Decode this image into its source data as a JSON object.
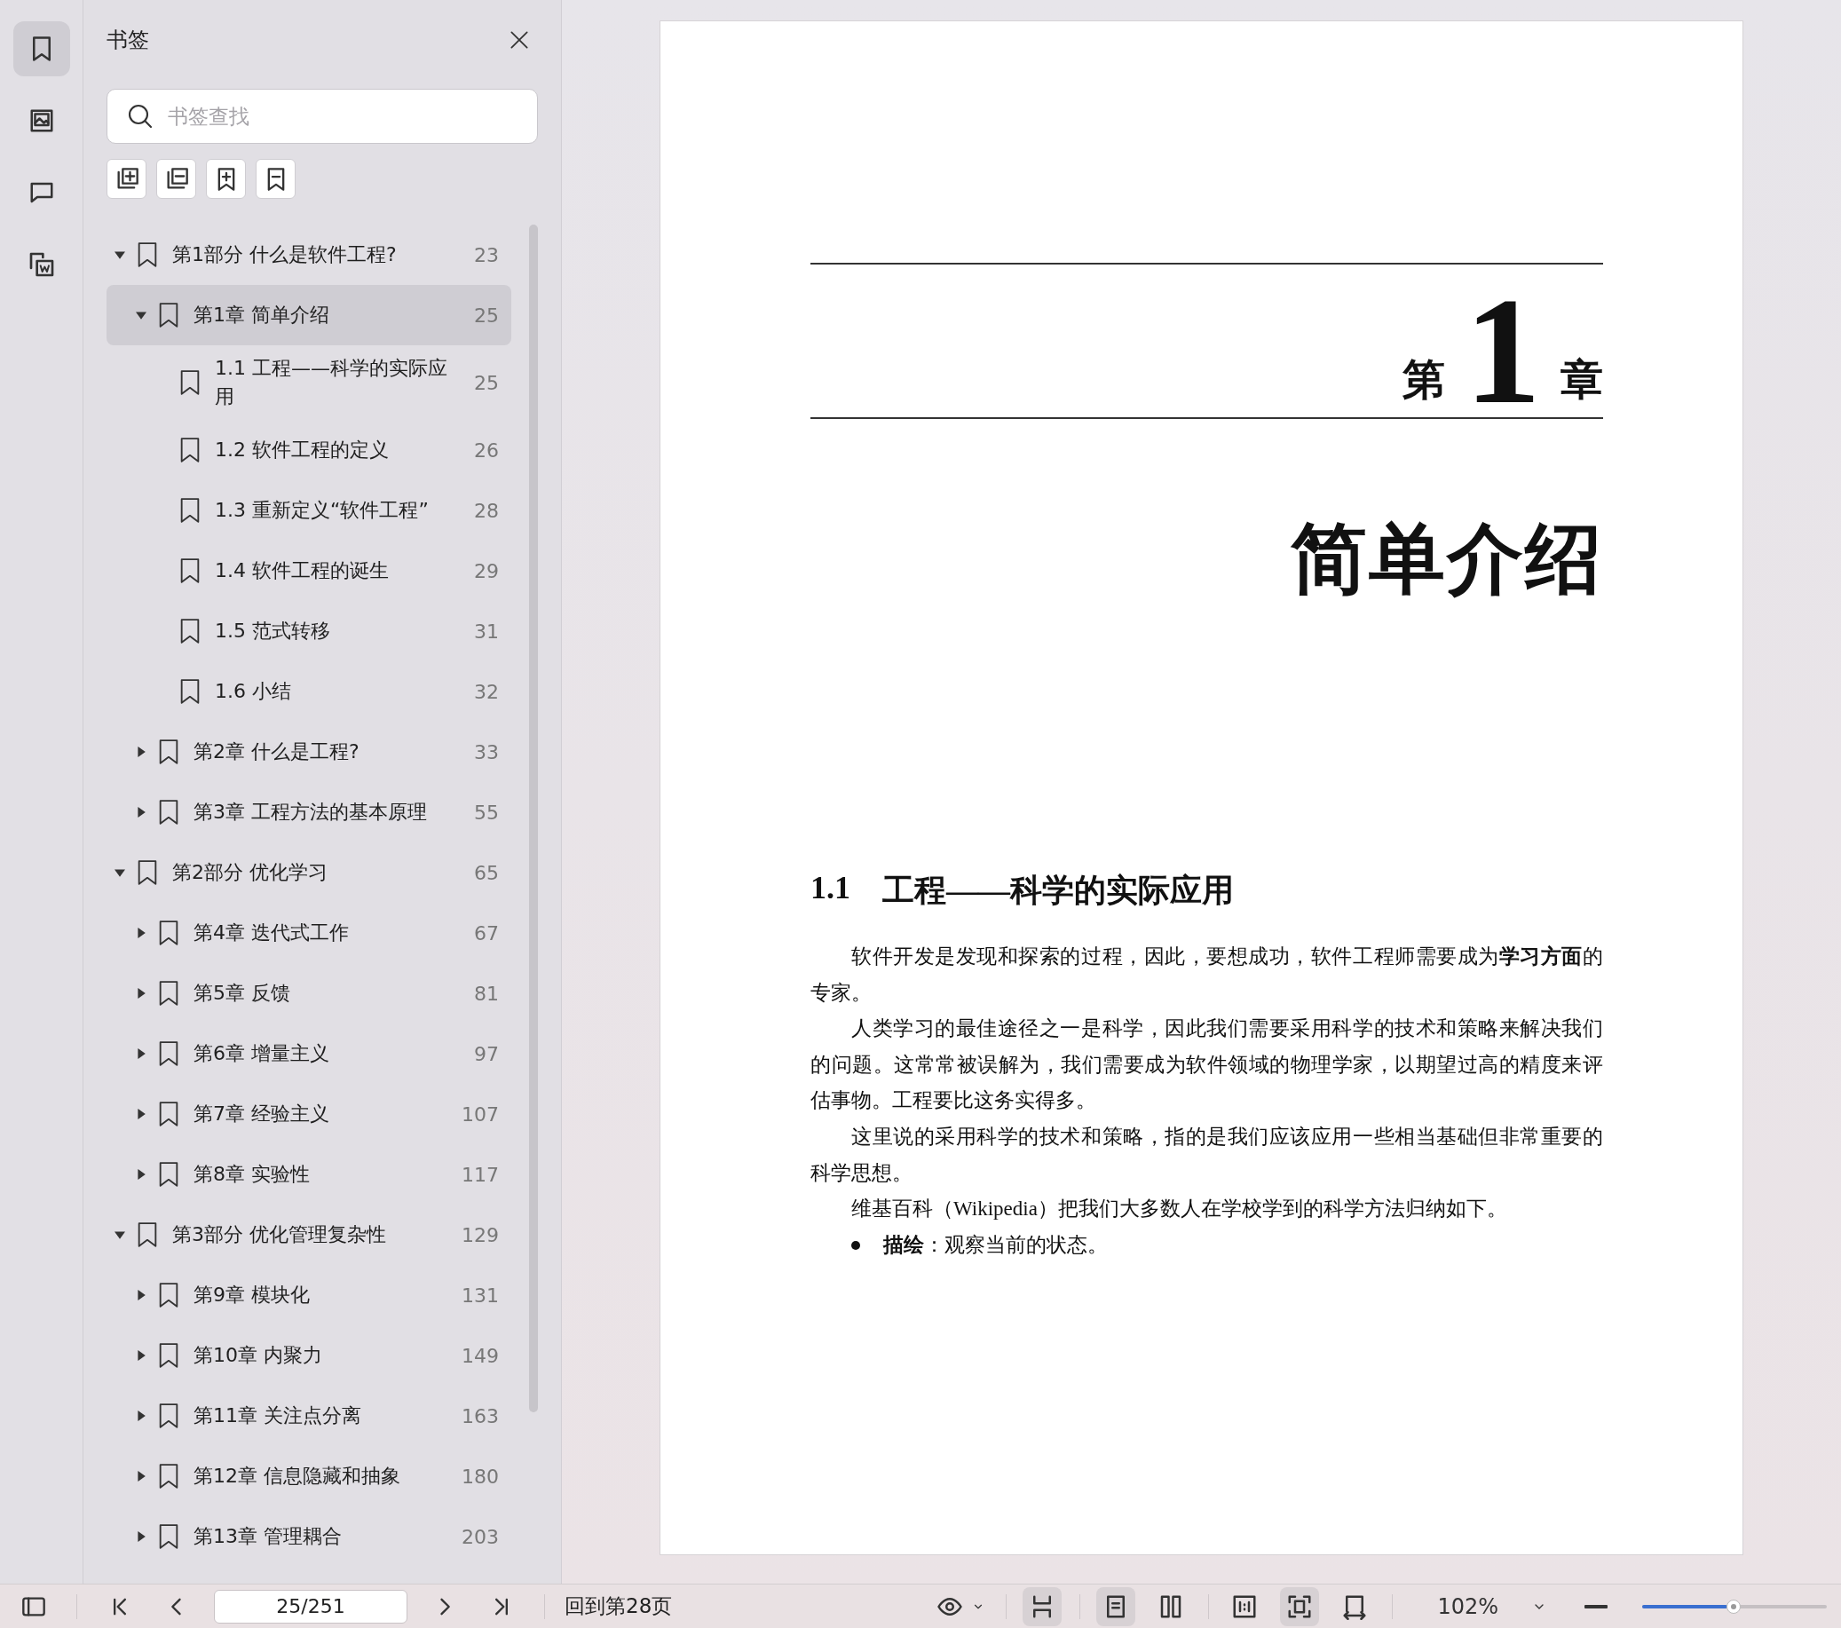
{
  "rail": [
    {
      "kind": "bookmark",
      "selected": true
    },
    {
      "kind": "image",
      "selected": false
    },
    {
      "kind": "comment",
      "selected": false
    },
    {
      "kind": "document",
      "selected": false
    }
  ],
  "sidebar": {
    "title": "书签",
    "search": {
      "placeholder": "书签查找"
    },
    "tools": [
      {
        "kind": "expand-all"
      },
      {
        "kind": "collapse-all"
      },
      {
        "kind": "add-bookmark"
      },
      {
        "kind": "remove-bookmark"
      }
    ],
    "tree": [
      {
        "label": "第1部分 什么是软件工程?",
        "page": "23",
        "expanded": true,
        "selected": false,
        "children": [
          {
            "label": "第1章 简单介绍",
            "page": "25",
            "expanded": true,
            "selected": true,
            "children": [
              {
                "label": "1.1 工程——科学的实际应用",
                "page": "25",
                "selected": false
              },
              {
                "label": "1.2 软件工程的定义",
                "page": "26",
                "selected": false
              },
              {
                "label": "1.3 重新定义“软件工程”",
                "page": "28",
                "selected": false
              },
              {
                "label": "1.4 软件工程的诞生",
                "page": "29",
                "selected": false
              },
              {
                "label": "1.5 范式转移",
                "page": "31",
                "selected": false
              },
              {
                "label": "1.6 小结",
                "page": "32",
                "selected": false
              }
            ]
          },
          {
            "label": "第2章 什么是工程?",
            "page": "33",
            "expanded": false,
            "selected": false
          },
          {
            "label": "第3章 工程方法的基本原理",
            "page": "55",
            "expanded": false,
            "selected": false
          }
        ]
      },
      {
        "label": "第2部分 优化学习",
        "page": "65",
        "expanded": true,
        "selected": false,
        "children": [
          {
            "label": "第4章 迭代式工作",
            "page": "67",
            "expanded": false,
            "selected": false
          },
          {
            "label": "第5章 反馈",
            "page": "81",
            "expanded": false,
            "selected": false
          },
          {
            "label": "第6章 增量主义",
            "page": "97",
            "expanded": false,
            "selected": false
          },
          {
            "label": "第7章 经验主义",
            "page": "107",
            "expanded": false,
            "selected": false
          },
          {
            "label": "第8章 实验性",
            "page": "117",
            "expanded": false,
            "selected": false
          }
        ]
      },
      {
        "label": "第3部分 优化管理复杂性",
        "page": "129",
        "expanded": true,
        "selected": false,
        "children": [
          {
            "label": "第9章 模块化",
            "page": "131",
            "expanded": false,
            "selected": false
          },
          {
            "label": "第10章 内聚力",
            "page": "149",
            "expanded": false,
            "selected": false
          },
          {
            "label": "第11章 关注点分离",
            "page": "163",
            "expanded": false,
            "selected": false
          },
          {
            "label": "第12章 信息隐藏和抽象",
            "page": "180",
            "expanded": false,
            "selected": false
          },
          {
            "label": "第13章 管理耦合",
            "page": "203",
            "expanded": false,
            "selected": false
          }
        ]
      }
    ]
  },
  "document": {
    "chapter_prefix": "第",
    "chapter_number": "1",
    "chapter_suffix": "章",
    "chapter_title": "简单介绍",
    "section_number": "1.1",
    "section_title": "工程——科学的实际应用",
    "paragraphs": [
      {
        "kind": "text",
        "text": "软件开发是发现和探索的过程，因此，要想成功，软件工程师需要成为**学习方面**的专家。"
      },
      {
        "kind": "text",
        "text": "人类学习的最佳途径之一是科学，因此我们需要采用科学的技术和策略来解决我们的问题。这常常被误解为，我们需要成为软件领域的物理学家，以期望过高的精度来评估事物。工程要比这务实得多。"
      },
      {
        "kind": "text",
        "text": "这里说的采用科学的技术和策略，指的是我们应该应用一些相当基础但非常重要的科学思想。"
      },
      {
        "kind": "text",
        "text": "维基百科（Wikipedia）把我们大多数人在学校学到的科学方法归纳如下。"
      },
      {
        "kind": "bullet",
        "text": "**描绘**：观察当前的状态。"
      }
    ]
  },
  "toolbar": {
    "page_field": {
      "value": "25/251"
    },
    "back_link": "回到第28页",
    "view_groups": [
      [
        {
          "kind": "eye",
          "selected": false
        }
      ],
      [
        {
          "kind": "fit-width",
          "selected": true
        }
      ],
      [
        {
          "kind": "single-page",
          "selected": true
        },
        {
          "kind": "two-page",
          "selected": false
        }
      ],
      [
        {
          "kind": "actual-size",
          "selected": false
        },
        {
          "kind": "fit-page",
          "selected": true
        },
        {
          "kind": "rotate",
          "selected": false
        }
      ]
    ],
    "zoom": "102%",
    "zoom_slider": {
      "level": 0.5
    }
  }
}
